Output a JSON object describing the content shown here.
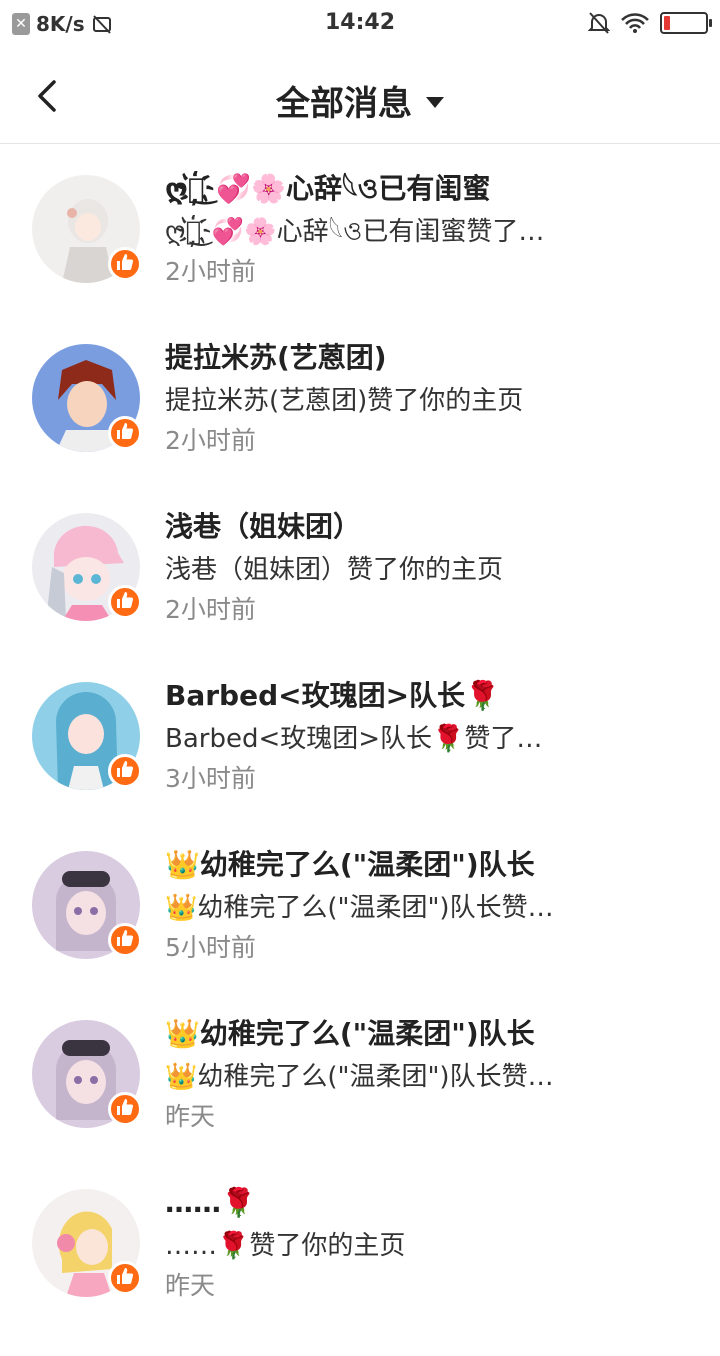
{
  "status_bar": {
    "net_speed": "8K/s",
    "time": "14:42",
    "battery_level": 0.15
  },
  "nav": {
    "title": "全部消息"
  },
  "colors": {
    "like_badge": "#ff6a13",
    "battery_low": "#e53935"
  },
  "messages": [
    {
      "name": "ღ⃢͜҉💞🌸心辞𓆩ও已有闺蜜",
      "text": "ღ⃢͜҉💞🌸心辞𓆩ও已有闺蜜赞了你的主页",
      "time": "2小时前",
      "avatar": "avatar-white-hair-girl"
    },
    {
      "name": "提拉米苏(艺蒽团)",
      "text": "提拉米苏(艺蒽团)赞了你的主页",
      "time": "2小时前",
      "avatar": "avatar-red-hair-boy"
    },
    {
      "name": "浅巷（姐妹团）",
      "text": "浅巷（姐妹团）赞了你的主页",
      "time": "2小时前",
      "avatar": "avatar-pink-cap-girl"
    },
    {
      "name": "Barbed<玫瑰团>队长🌹",
      "text": "Barbed<玫瑰团>队长🌹赞了你的主页",
      "time": "3小时前",
      "avatar": "avatar-blue-hair-girl"
    },
    {
      "name": "👑幼稚完了么(\"温柔团\")队长",
      "text": "👑幼稚完了么(\"温柔团\")队长赞了你的主页",
      "time": "5小时前",
      "avatar": "avatar-goggles-girl"
    },
    {
      "name": "👑幼稚完了么(\"温柔团\")队长",
      "text": "👑幼稚完了么(\"温柔团\")队长赞了你的主页",
      "time": "昨天",
      "avatar": "avatar-goggles-girl"
    },
    {
      "name": "……🌹",
      "text": "……🌹赞了你的主页",
      "time": "昨天",
      "avatar": "avatar-headphone-girl"
    }
  ]
}
